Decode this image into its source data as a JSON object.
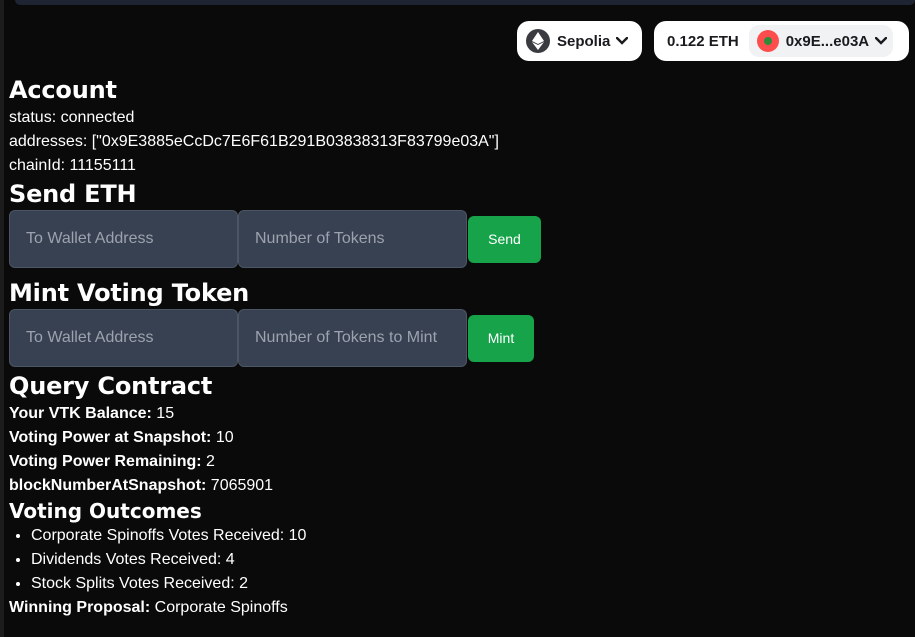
{
  "header": {
    "network": {
      "name": "Sepolia",
      "icon": "ethereum-icon"
    },
    "account": {
      "balance": "0.122 ETH",
      "address_short": "0x9E...e03A",
      "avatar_icon": "avatar-icon"
    }
  },
  "account_section": {
    "title": "Account",
    "status": "status: connected",
    "addresses": "addresses: [\"0x9E3885eCcDc7E6F61B291B03838313F83799e03A\"]",
    "chainId": "chainId: 11155111"
  },
  "send_section": {
    "title": "Send ETH",
    "to_placeholder": "To Wallet Address",
    "amount_placeholder": "Number of Tokens",
    "button": "Send"
  },
  "mint_section": {
    "title": "Mint Voting Token",
    "to_placeholder": "To Wallet Address",
    "amount_placeholder": "Number of Tokens to Mint",
    "button": "Mint"
  },
  "query_section": {
    "title": "Query Contract",
    "rows": [
      {
        "label": "Your VTK Balance:",
        "value": " 15"
      },
      {
        "label": "Voting Power at Snapshot:",
        "value": " 10"
      },
      {
        "label": "Voting Power Remaining:",
        "value": " 2"
      },
      {
        "label": "blockNumberAtSnapshot:",
        "value": " 7065901"
      }
    ]
  },
  "outcomes_section": {
    "title": "Voting Outcomes",
    "items": [
      "Corporate Spinoffs Votes Received: 10",
      "Dividends Votes Received: 4",
      "Stock Splits Votes Received: 2"
    ],
    "winner_label": "Winning Proposal:",
    "winner_value": " Corporate Spinoffs"
  },
  "colors": {
    "background": "#0a0a0a",
    "button_green": "#16a34a",
    "input_bg": "#374151"
  }
}
